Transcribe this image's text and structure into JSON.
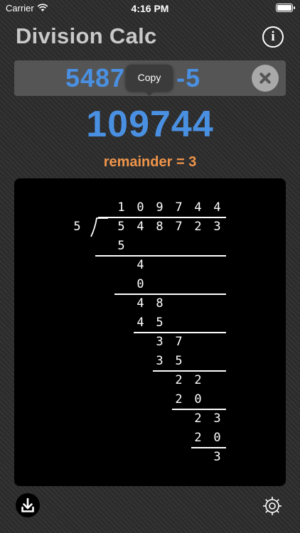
{
  "status": {
    "carrier": "Carrier",
    "time": "4:16 PM"
  },
  "header": {
    "title": "Division Calc",
    "info_icon": "info-icon"
  },
  "input": {
    "value": "5487|||-5",
    "visible_left": "5487",
    "visible_right": "-5",
    "clear_icon": "clear-icon"
  },
  "popup": {
    "label": "Copy"
  },
  "result": {
    "quotient": "109744",
    "remainder_label": "remainder = 3"
  },
  "long_division": {
    "divisor": "5",
    "dividend": "548723",
    "quotient": "109744",
    "steps": [
      [
        "5"
      ],
      [
        "4"
      ],
      [
        "0"
      ],
      [
        "4",
        "8"
      ],
      [
        "4",
        "5"
      ],
      [
        "3",
        "7"
      ],
      [
        "3",
        "5"
      ],
      [
        "2",
        "2"
      ],
      [
        "2",
        "0"
      ],
      [
        "2",
        "3"
      ],
      [
        "2",
        "0"
      ],
      [
        "3"
      ]
    ]
  },
  "toolbar": {
    "download_icon": "download-icon",
    "settings_icon": "gear-icon"
  },
  "colors": {
    "accent": "#4a90e2",
    "remainder": "#f0954a",
    "background": "#2b2b2b",
    "panel": "#000000"
  }
}
